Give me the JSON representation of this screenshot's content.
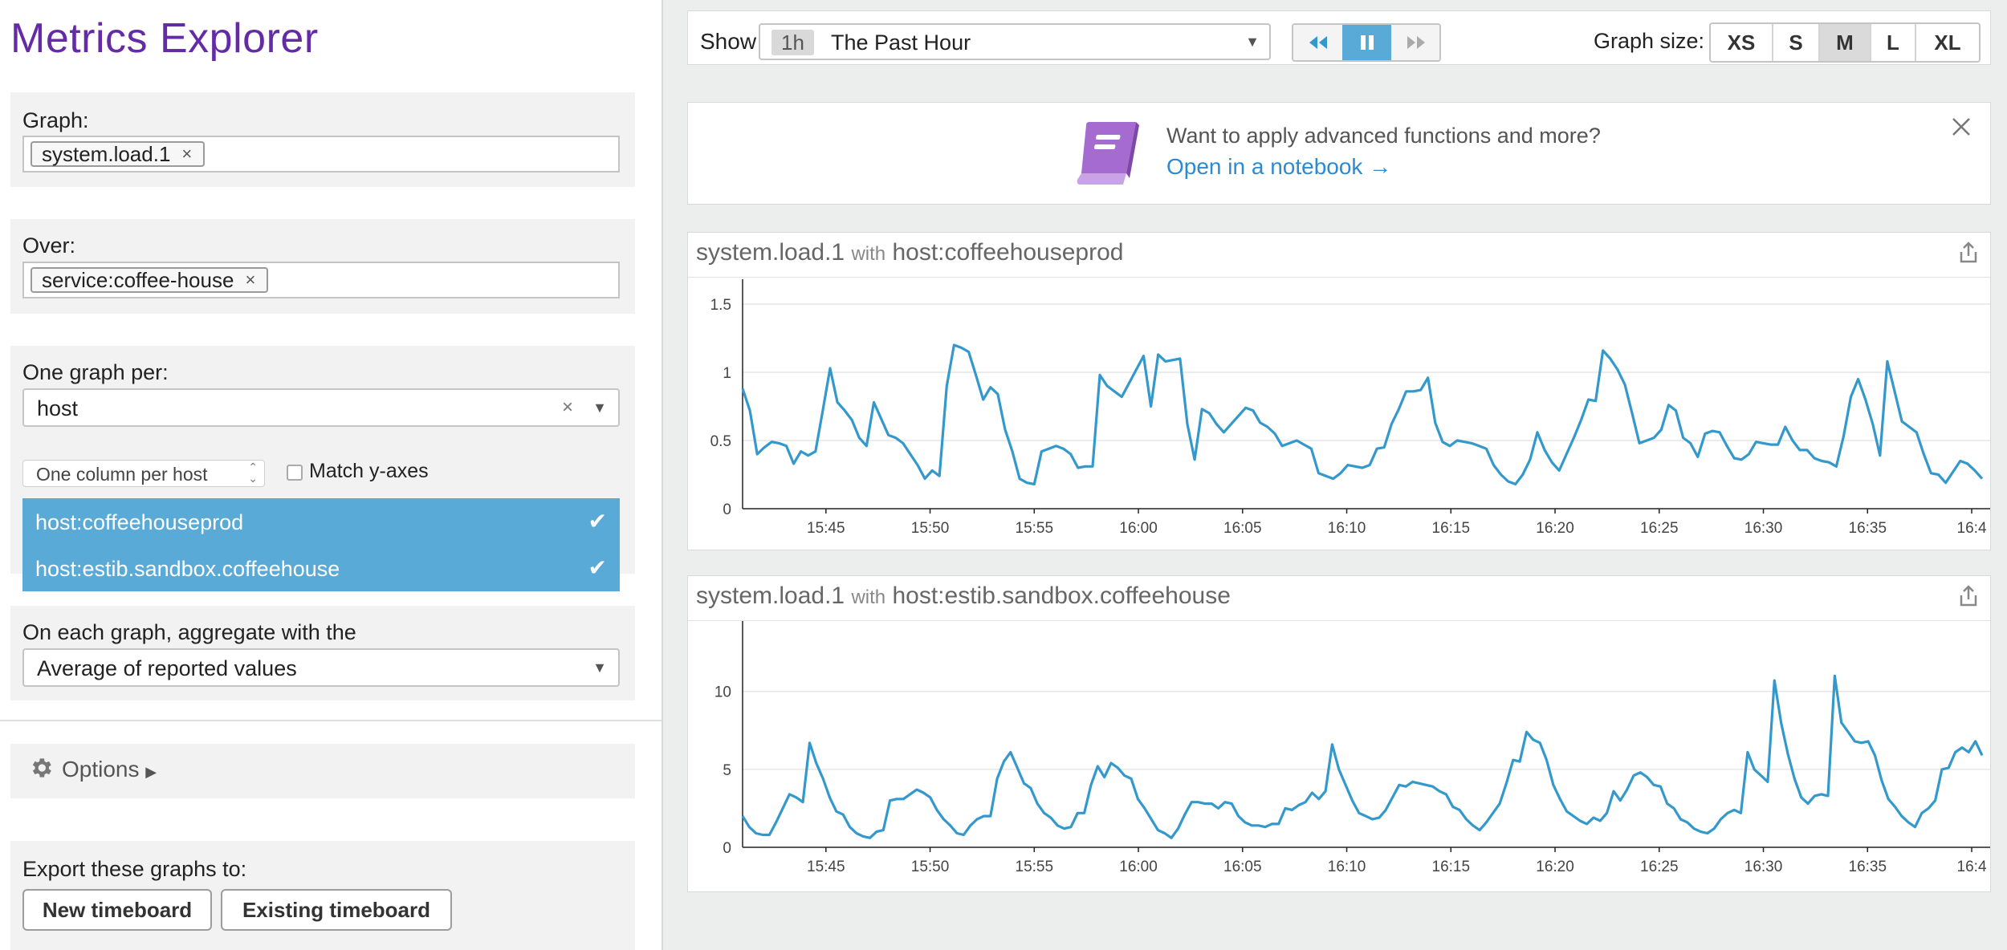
{
  "app_title": "Metrics Explorer",
  "sidebar": {
    "graph_label": "Graph:",
    "graph_tag": "system.load.1",
    "over_label": "Over:",
    "over_tag": "service:coffee-house",
    "per_label": "One graph per:",
    "per_value": "host",
    "column_select": "One column per host",
    "match_y_label": "Match y-axes",
    "match_y_checked": false,
    "hosts": [
      {
        "label": "host:coffeehouseprod",
        "selected": true
      },
      {
        "label": "host:estib.sandbox.coffeehouse",
        "selected": true
      }
    ],
    "aggregate_label": "On each graph, aggregate with the",
    "aggregate_value": "Average of reported values",
    "options_label": "Options",
    "export_label": "Export these graphs to:",
    "new_timeboard": "New timeboard",
    "existing_timeboard": "Existing timeboard"
  },
  "toolbar": {
    "show_label": "Show",
    "time_badge": "1h",
    "time_range": "The Past Hour",
    "graph_size_label": "Graph size:",
    "sizes": [
      "XS",
      "S",
      "M",
      "L",
      "XL"
    ],
    "active_size": "M"
  },
  "banner": {
    "text": "Want to apply advanced functions and more?",
    "link": "Open in a notebook →"
  },
  "graphs": [
    {
      "metric": "system.load.1",
      "with": "with",
      "scope": "host:coffeehouseprod"
    },
    {
      "metric": "system.load.1",
      "with": "with",
      "scope": "host:estib.sandbox.coffeehouse"
    }
  ],
  "colors": {
    "line": "#3399cc",
    "accent": "#632ca6",
    "selection": "#5aaad8",
    "link": "#2b8ad3"
  },
  "chart_data": [
    {
      "type": "line",
      "x_ticks": [
        "15:45",
        "15:50",
        "15:55",
        "16:00",
        "16:05",
        "16:10",
        "16:15",
        "16:20",
        "16:25",
        "16:30",
        "16:35",
        "16:4"
      ],
      "y_ticks": [
        "0",
        "0.5",
        "1",
        "1.5"
      ],
      "ylim": [
        0,
        1.6
      ],
      "xlim_minutes": [
        0,
        59.5
      ],
      "grid": true,
      "series": [
        {
          "values": [
            0.88,
            0.72,
            0.4,
            0.45,
            0.49,
            0.48,
            0.46,
            0.33,
            0.42,
            0.39,
            0.42,
            0.72,
            1.03,
            0.78,
            0.72,
            0.65,
            0.52,
            0.46,
            0.78,
            0.66,
            0.54,
            0.52,
            0.48,
            0.4,
            0.32,
            0.22,
            0.28,
            0.24,
            0.9,
            1.2,
            1.18,
            1.15,
            0.98,
            0.8,
            0.89,
            0.84,
            0.58,
            0.42,
            0.22,
            0.19,
            0.18,
            0.42,
            0.44,
            0.46,
            0.44,
            0.4,
            0.3,
            0.31,
            0.31,
            0.98,
            0.9,
            0.86,
            0.82,
            0.92,
            1.02,
            1.12,
            0.75,
            1.13,
            1.08,
            1.09,
            1.1,
            0.62,
            0.36,
            0.73,
            0.7,
            0.62,
            0.56,
            0.62,
            0.68,
            0.74,
            0.72,
            0.63,
            0.6,
            0.55,
            0.46,
            0.48,
            0.5,
            0.47,
            0.44,
            0.26,
            0.24,
            0.22,
            0.26,
            0.32,
            0.31,
            0.3,
            0.32,
            0.44,
            0.45,
            0.62,
            0.73,
            0.86,
            0.86,
            0.87,
            0.96,
            0.63,
            0.49,
            0.46,
            0.5,
            0.49,
            0.48,
            0.46,
            0.44,
            0.32,
            0.25,
            0.2,
            0.18,
            0.25,
            0.36,
            0.56,
            0.43,
            0.34,
            0.28,
            0.4,
            0.52,
            0.65,
            0.8,
            0.79,
            1.16,
            1.1,
            1.02,
            0.91,
            0.7,
            0.48,
            0.5,
            0.52,
            0.58,
            0.76,
            0.72,
            0.52,
            0.48,
            0.38,
            0.55,
            0.57,
            0.56,
            0.46,
            0.37,
            0.36,
            0.4,
            0.49,
            0.48,
            0.47,
            0.47,
            0.6,
            0.5,
            0.43,
            0.43,
            0.37,
            0.35,
            0.34,
            0.31,
            0.53,
            0.82,
            0.95,
            0.8,
            0.62,
            0.39,
            1.08,
            0.86,
            0.64,
            0.6,
            0.56,
            0.4,
            0.26,
            0.25,
            0.19,
            0.27,
            0.35,
            0.33,
            0.28,
            0.22
          ]
        }
      ]
    },
    {
      "type": "line",
      "x_ticks": [
        "15:45",
        "15:50",
        "15:55",
        "16:00",
        "16:05",
        "16:10",
        "16:15",
        "16:20",
        "16:25",
        "16:30",
        "16:35",
        "16:4"
      ],
      "y_ticks": [
        "0",
        "5",
        "10"
      ],
      "ylim": [
        0,
        14
      ],
      "xlim_minutes": [
        0,
        59.5
      ],
      "grid": true,
      "series": [
        {
          "values": [
            2.0,
            1.3,
            0.9,
            0.8,
            0.8,
            1.6,
            2.5,
            3.4,
            3.2,
            2.9,
            6.7,
            5.4,
            4.4,
            3.2,
            2.3,
            2.1,
            1.3,
            0.9,
            0.7,
            0.6,
            1.0,
            1.1,
            3.0,
            3.1,
            3.1,
            3.4,
            3.7,
            3.5,
            3.2,
            2.4,
            1.8,
            1.4,
            0.9,
            0.8,
            1.4,
            1.8,
            2.0,
            2.0,
            4.4,
            5.5,
            6.1,
            5.1,
            4.1,
            3.8,
            2.8,
            2.2,
            1.9,
            1.4,
            1.2,
            1.3,
            2.2,
            2.2,
            4.0,
            5.2,
            4.5,
            5.4,
            5.1,
            4.6,
            4.4,
            3.1,
            2.5,
            1.8,
            1.1,
            0.9,
            0.6,
            1.2,
            2.1,
            2.9,
            2.9,
            2.8,
            2.8,
            2.5,
            2.9,
            2.8,
            2.0,
            1.6,
            1.4,
            1.4,
            1.3,
            1.5,
            1.5,
            2.5,
            2.4,
            2.7,
            2.9,
            3.5,
            3.1,
            3.6,
            6.6,
            5.0,
            4.0,
            3.0,
            2.2,
            2.0,
            1.8,
            1.9,
            2.4,
            3.2,
            4.0,
            3.9,
            4.2,
            4.1,
            4.0,
            3.9,
            3.6,
            3.4,
            2.6,
            2.4,
            1.8,
            1.4,
            1.1,
            1.6,
            2.2,
            2.8,
            4.1,
            5.6,
            5.5,
            7.4,
            6.9,
            6.7,
            5.6,
            4.0,
            3.1,
            2.3,
            2.0,
            1.7,
            1.5,
            1.9,
            1.7,
            2.2,
            3.6,
            3.0,
            3.7,
            4.6,
            4.8,
            4.5,
            4.0,
            3.9,
            2.8,
            2.5,
            1.8,
            1.6,
            1.2,
            1.0,
            0.9,
            1.2,
            1.8,
            2.2,
            2.4,
            2.2,
            6.1,
            5.0,
            4.6,
            4.2,
            10.7,
            8.0,
            6.0,
            4.4,
            3.2,
            2.8,
            3.3,
            3.4,
            3.3,
            11.0,
            8.0,
            7.4,
            6.8,
            6.7,
            6.8,
            5.9,
            4.3,
            3.1,
            2.6,
            2.0,
            1.6,
            1.3,
            2.2,
            2.5,
            3.0,
            5.0,
            5.1,
            6.1,
            6.4,
            6.1,
            6.8,
            5.9
          ]
        }
      ]
    }
  ]
}
